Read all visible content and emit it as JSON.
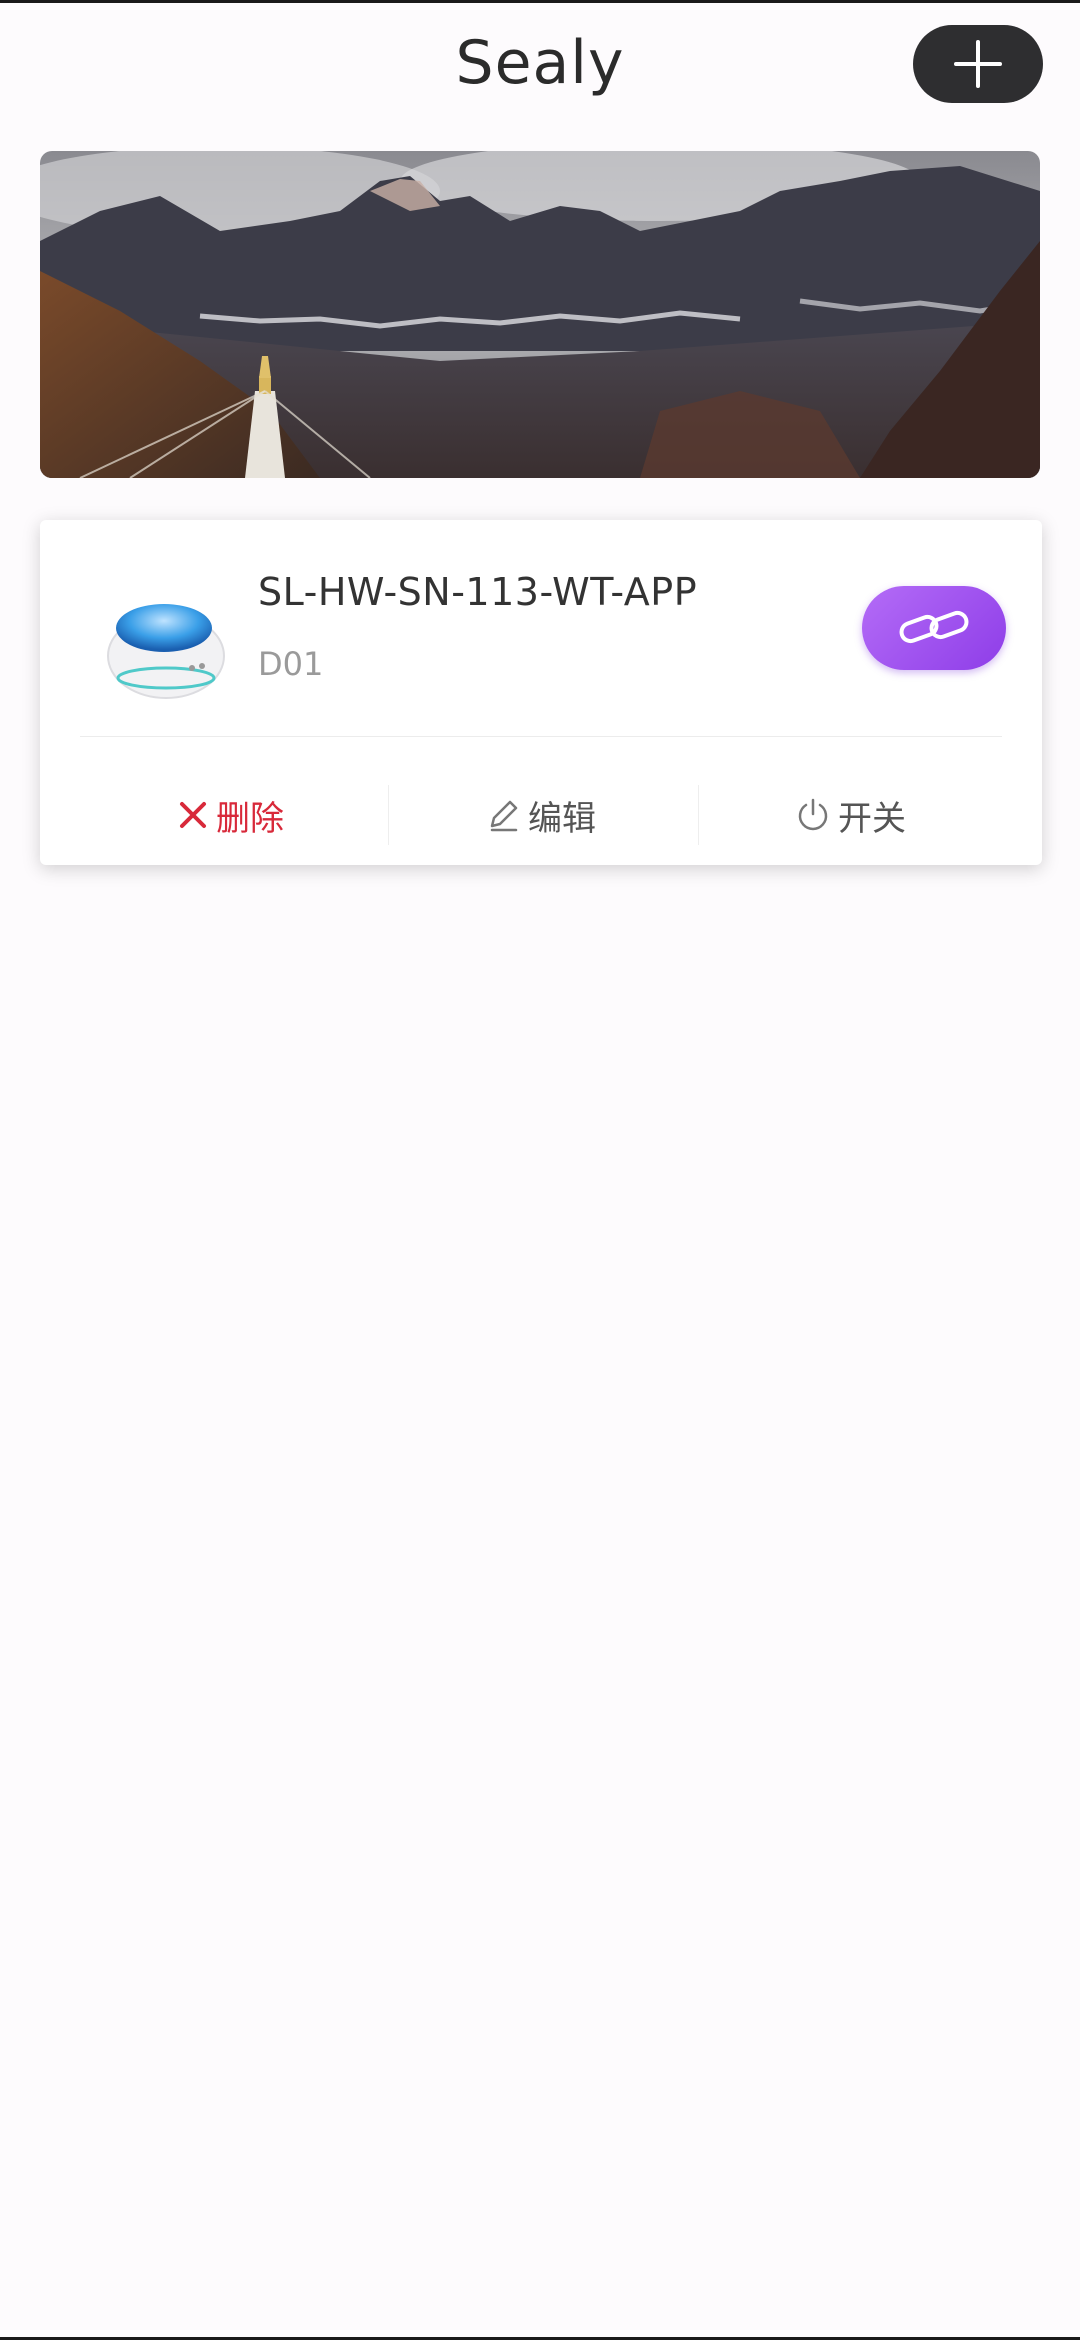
{
  "header": {
    "title": "Sealy",
    "add_icon": "plus-icon"
  },
  "banner": {
    "image": "mountain-landscape-with-stupa"
  },
  "device_card": {
    "name": "SL-HW-SN-113-WT-APP",
    "id": "D01",
    "link_icon": "link-icon",
    "actions": [
      {
        "label": "删除",
        "icon": "close-icon",
        "color": "#d8293a"
      },
      {
        "label": "编辑",
        "icon": "pencil-icon",
        "color": "#555555"
      },
      {
        "label": "开关",
        "icon": "power-icon",
        "color": "#555555"
      }
    ]
  },
  "colors": {
    "accent": "#9b4ff0",
    "add_button": "#2e2e30",
    "delete": "#d8293a",
    "background": "#fdfbfd"
  }
}
